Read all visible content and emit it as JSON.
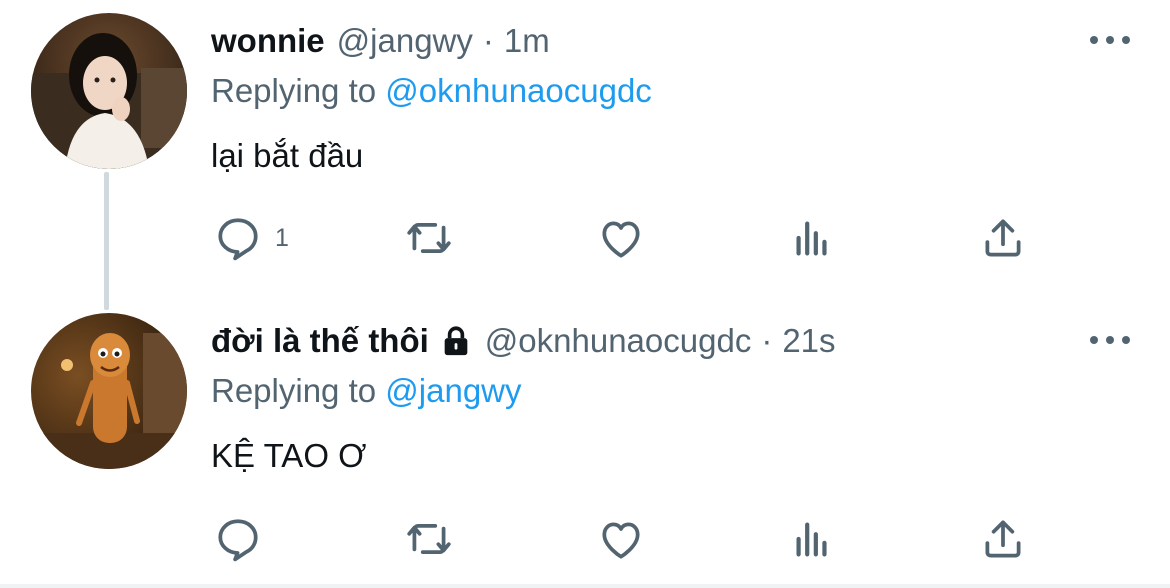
{
  "tweets": [
    {
      "name": "wonnie",
      "handle": "@jangwy",
      "separator": "·",
      "time": "1m",
      "replying_prefix": "Replying to",
      "replying_to": "@oknhunaocugdc",
      "text": "lại bắt đầu",
      "reply_count": "1",
      "locked": false,
      "avatar": "profile-photo-woman-icon"
    },
    {
      "name": "đời là thế thôi",
      "handle": "@oknhunaocugdc",
      "separator": "·",
      "time": "21s",
      "replying_prefix": "Replying to",
      "replying_to": "@jangwy",
      "text": "KỆ TAO Ơ",
      "reply_count": "",
      "locked": true,
      "avatar": "cartoon-character-avatar-icon"
    }
  ],
  "icons": [
    "reply-icon",
    "retweet-icon",
    "like-icon",
    "views-icon",
    "share-icon",
    "more-icon",
    "lock-icon"
  ],
  "colors": {
    "text": "#0f1419",
    "secondary": "#536471",
    "link": "#1d9bf0",
    "thread_line": "#cfd9de"
  }
}
